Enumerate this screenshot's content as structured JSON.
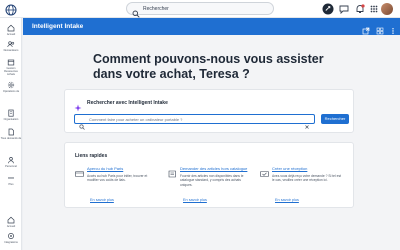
{
  "topbar": {
    "search_text": "Rechercher"
  },
  "sidebar": {
    "items": [
      {
        "label": "Accueil",
        "icon": "home-icon"
      },
      {
        "label": "Demandeurs",
        "icon": "people-icon"
      },
      {
        "label": "Gestion Ressources Achats",
        "icon": "box-icon"
      },
      {
        "label": "Opérations de",
        "icon": "gear-icon"
      },
      {
        "label": "Organisation",
        "icon": "building-icon"
      },
      {
        "label": "Tous demands de",
        "icon": "doc-icon"
      },
      {
        "label": "Personnel",
        "icon": "person-icon"
      },
      {
        "label": "Plus",
        "icon": "more-icon"
      },
      {
        "label": "Accueil",
        "icon": "home-icon"
      },
      {
        "label": "Intégrations",
        "icon": "plug-icon"
      }
    ]
  },
  "header": {
    "title": "Intelligent Intake"
  },
  "main": {
    "headline": "Comment pouvons-nous vous assister dans votre achat, Teresa ?",
    "search_card": {
      "title": "Rechercher avec Intelligent Intake",
      "input_placeholder": "Comment faire pour acheter un ordinateur portable ?",
      "button_label": "Rechercher"
    },
    "quick_links": {
      "title": "Liens rapides",
      "items": [
        {
          "title": "Apercu du hub Paris",
          "description": "Accès au hub Paris pour initier, trouver et modifier vos coûts de liais.",
          "link": "En savoir plus"
        },
        {
          "title": "Demander des articles hors catalogue",
          "description": "Fournir des articles non disponibles dans le catalogue standard, y compris des achats uniques.",
          "link": "En savoir plus"
        },
        {
          "title": "Créer une réception",
          "description": "Avez-vous déjà reçu votre demande ? Si tel est le cas, veuillez créer une réception ici.",
          "link": "En savoir plus"
        }
      ]
    }
  },
  "colors": {
    "accent": "#1f6fd1",
    "background": "#f3f4f6"
  }
}
